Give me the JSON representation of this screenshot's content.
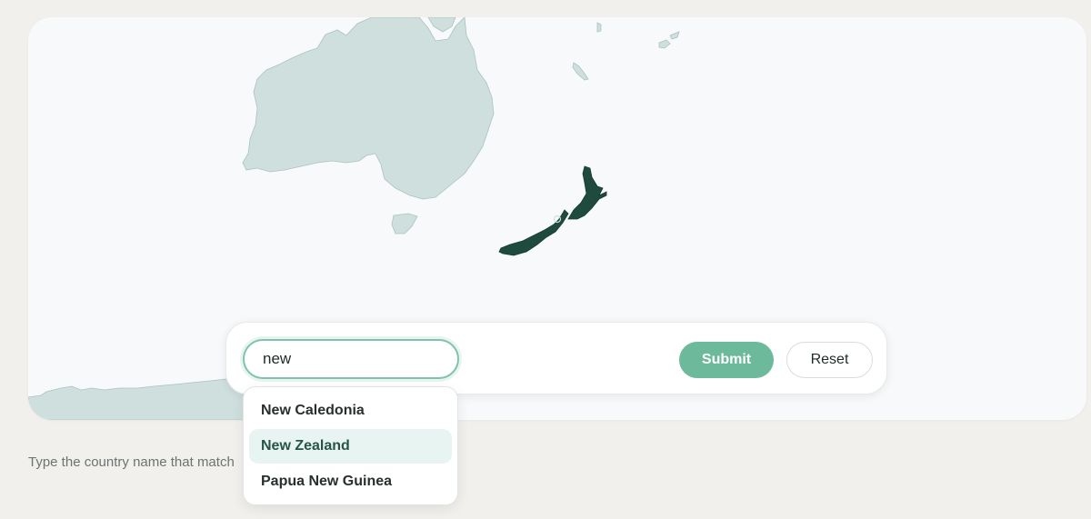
{
  "map": {
    "target_country": "New Zealand",
    "colors": {
      "background": "#f7f9fb",
      "land": "#cfdfdd",
      "land_border": "#a9c3c0",
      "target": "#1f4b3f"
    }
  },
  "search": {
    "value": "new",
    "placeholder": ""
  },
  "buttons": {
    "submit_label": "Submit",
    "reset_label": "Reset"
  },
  "suggestions": {
    "items": [
      {
        "label": "New Caledonia",
        "highlighted": false
      },
      {
        "label": "New Zealand",
        "highlighted": true
      },
      {
        "label": "Papua New Guinea",
        "highlighted": false
      }
    ]
  },
  "hint": {
    "text": "Type the country name that match"
  },
  "colors": {
    "accent": "#6cb99c",
    "page_background": "#f2f0ec"
  }
}
